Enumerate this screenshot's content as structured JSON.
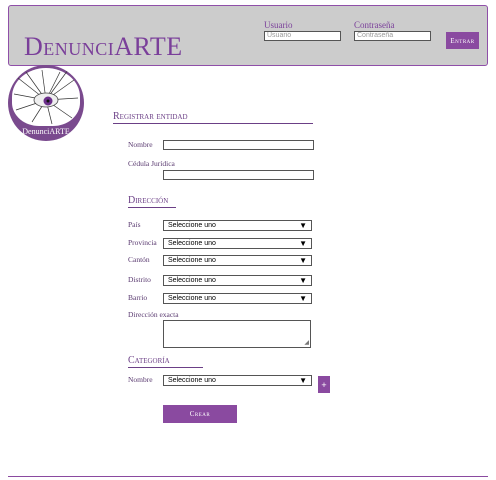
{
  "header": {
    "brand": "DenunciARTE",
    "user_label": "Usuario",
    "user_placeholder": "Usuario",
    "password_label": "Contraseña",
    "password_placeholder": "Contraseña",
    "enter_label": "Entrar"
  },
  "logo": {
    "text": "DenunciARTE"
  },
  "form": {
    "title": "Registrar entidad",
    "name_label": "Nombre",
    "cedula_label": "Cédula Jurídica",
    "address_title": "Dirección",
    "pais_label": "País",
    "provincia_label": "Provincia",
    "canton_label": "Cantón",
    "distrito_label": "Distrito",
    "barrio_label": "Barrio",
    "select_default": "Seleccione uno",
    "exact_label": "Dirección exacta",
    "category_title": "Categoría",
    "category_name_label": "Nombre",
    "add_label": "+",
    "create_label": "Crear"
  },
  "colors": {
    "accent": "#8a4aa0",
    "header_bg": "#cccccc",
    "text": "#6b3f86"
  }
}
